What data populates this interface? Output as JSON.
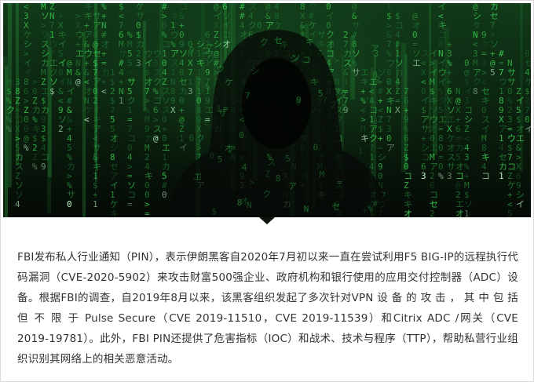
{
  "hero_image": {
    "description_icon": "matrix-hacker-silhouette-image",
    "colors": {
      "background": "#0b1f0e",
      "code_green": "#39d353",
      "code_dim": "#1f7a34",
      "silhouette": "#070b07",
      "highlight": "#c8ffd0"
    }
  },
  "caption": {
    "text": "FBI发布私人行业通知（PIN），表示伊朗黑客自2020年7月初以来一直在尝试利用F5 BIG-IP的远程执行代码漏洞（CVE-2020-5902）来攻击财富500强企业、政府机构和银行使用的应用交付控制器（ADC）设备。根据FBI的调查，自2019年8月以来，该黑客组织发起了多次针对VPN 设 备 的 攻 击 ， 其 中 包 括 但 不 限 于 Pulse  Secure（CVE  2019-11510，CVE 2019-11539）和Citrix ADC /网关（CVE 2019-19781）。此外，FBI PIN还提供了危害指标（IOC）和战术、技术与程序（TTP），帮助私营行业组织识别其网络上的相关恶意活动。"
  }
}
